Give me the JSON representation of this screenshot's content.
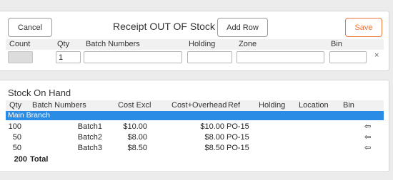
{
  "receipt": {
    "cancel_label": "Cancel",
    "title": "Receipt OUT OF Stock",
    "add_row_label": "Add Row",
    "save_label": "Save",
    "columns": [
      "Count",
      "Qty",
      "Batch Numbers",
      "Holding",
      "Zone",
      "Bin"
    ],
    "row": {
      "count": "",
      "qty": "1",
      "batch_numbers": "",
      "holding": "",
      "zone": "",
      "bin": ""
    },
    "remove_icon": "close-icon",
    "remove_glyph": "×",
    "save_color": "#e8773a"
  },
  "stock": {
    "title": "Stock On Hand",
    "columns": [
      "Qty",
      "Batch Numbers",
      "Cost Excl",
      "Cost+Overhead",
      "Ref",
      "Holding",
      "Location",
      "Bin"
    ],
    "branch": "Main Branch",
    "branch_color": "#2b8ce6",
    "rows": [
      {
        "qty": "100",
        "batch": "Batch1",
        "cost_excl": "$10.00",
        "cost_overhead": "$10.00",
        "ref": "PO-15",
        "holding": "",
        "location": "",
        "bin": "",
        "action_icon": "arrow-left-icon",
        "action_glyph": "⇦"
      },
      {
        "qty": "50",
        "batch": "Batch2",
        "cost_excl": "$8.00",
        "cost_overhead": "$8.00",
        "ref": "PO-15",
        "holding": "",
        "location": "",
        "bin": "",
        "action_icon": "arrow-left-icon",
        "action_glyph": "⇦"
      },
      {
        "qty": "50",
        "batch": "Batch3",
        "cost_excl": "$8.50",
        "cost_overhead": "$8.50",
        "ref": "PO-15",
        "holding": "",
        "location": "",
        "bin": "",
        "action_icon": "arrow-left-icon",
        "action_glyph": "⇦"
      }
    ],
    "total": {
      "qty": "200",
      "label": "Total"
    }
  }
}
